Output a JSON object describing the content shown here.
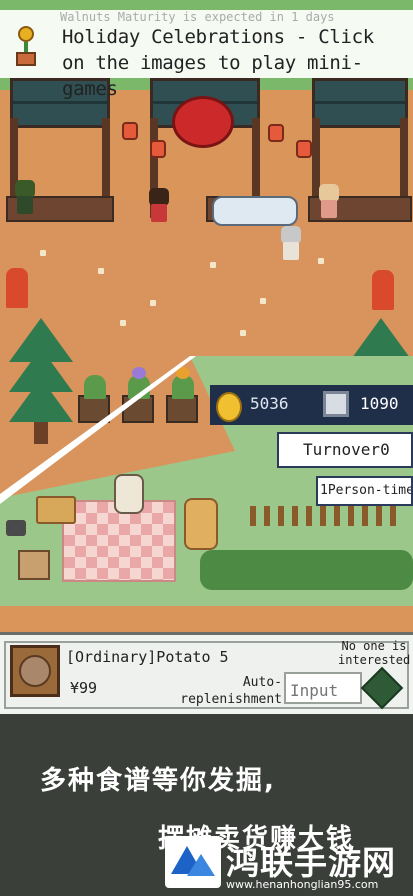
{
  "header": {
    "ghost_text": "Walnuts Maturity is expected in 1 days",
    "title": "Holiday Celebrations - Click on the images to play mini-games"
  },
  "hud": {
    "coins": "5036",
    "gems": "1090",
    "turnover": "Turnover0",
    "person_time": "1Person-time"
  },
  "shop_item": {
    "name": "[Ordinary]Potato 5",
    "price": "¥99",
    "auto_label": "Auto-replenishment",
    "input_placeholder": "Input",
    "interest_status": "No one is interested"
  },
  "promo": {
    "line1": "多种食谱等你发掘,",
    "line2": "摆摊卖货赚大钱"
  },
  "watermark": {
    "site_name": "鸿联手游网",
    "url": "www.henanhonglian95.com"
  },
  "colors": {
    "sky_grass": "#7bb86a",
    "ground": "#d8945c",
    "stall_roof": "#2f4f52",
    "hud_blue": "#1f2f4a",
    "accent_green": "#2f5a36",
    "promo_bg": "#3b3f3a"
  },
  "icons": {
    "title": "flower-pot-icon",
    "coin": "coin-icon",
    "gem": "gem-icon",
    "item": "potato-icon",
    "confirm": "diamond-button-icon",
    "watermark": "mountain-logo-icon"
  }
}
